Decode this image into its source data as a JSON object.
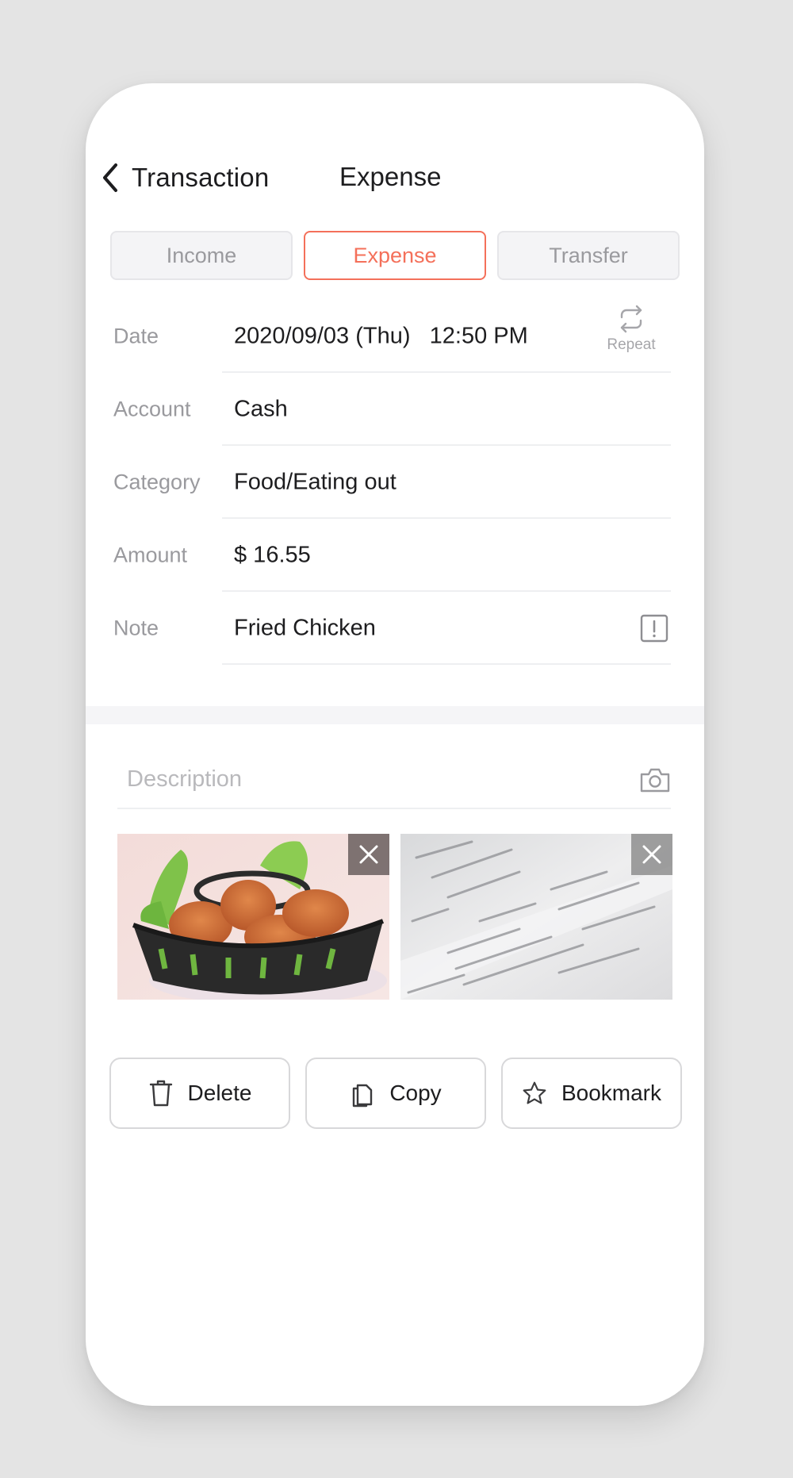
{
  "header": {
    "back_label": "Transaction",
    "title": "Expense"
  },
  "type_tabs": [
    {
      "label": "Income",
      "selected": false
    },
    {
      "label": "Expense",
      "selected": true
    },
    {
      "label": "Transfer",
      "selected": false
    }
  ],
  "form": {
    "date": {
      "label": "Date",
      "value": "2020/09/03 (Thu)   12:50 PM",
      "repeat_label": "Repeat"
    },
    "account": {
      "label": "Account",
      "value": "Cash"
    },
    "category": {
      "label": "Category",
      "value": "Food/Eating out"
    },
    "amount": {
      "label": "Amount",
      "value": "$ 16.55"
    },
    "note": {
      "label": "Note",
      "value": "Fried Chicken"
    }
  },
  "description": {
    "placeholder": "Description",
    "value": ""
  },
  "photos": [
    {
      "subject": "Fried chicken in a basket",
      "icon": "close-icon"
    },
    {
      "subject": "Receipt",
      "icon": "close-icon"
    }
  ],
  "actions": [
    {
      "label": "Delete",
      "icon": "trash-icon"
    },
    {
      "label": "Copy",
      "icon": "copy-icon"
    },
    {
      "label": "Bookmark",
      "icon": "star-icon"
    }
  ],
  "colors": {
    "accent": "#f4705a",
    "label_gray": "#9a9a9e",
    "text": "#1d1d1f",
    "background": "#e4e4e4"
  }
}
